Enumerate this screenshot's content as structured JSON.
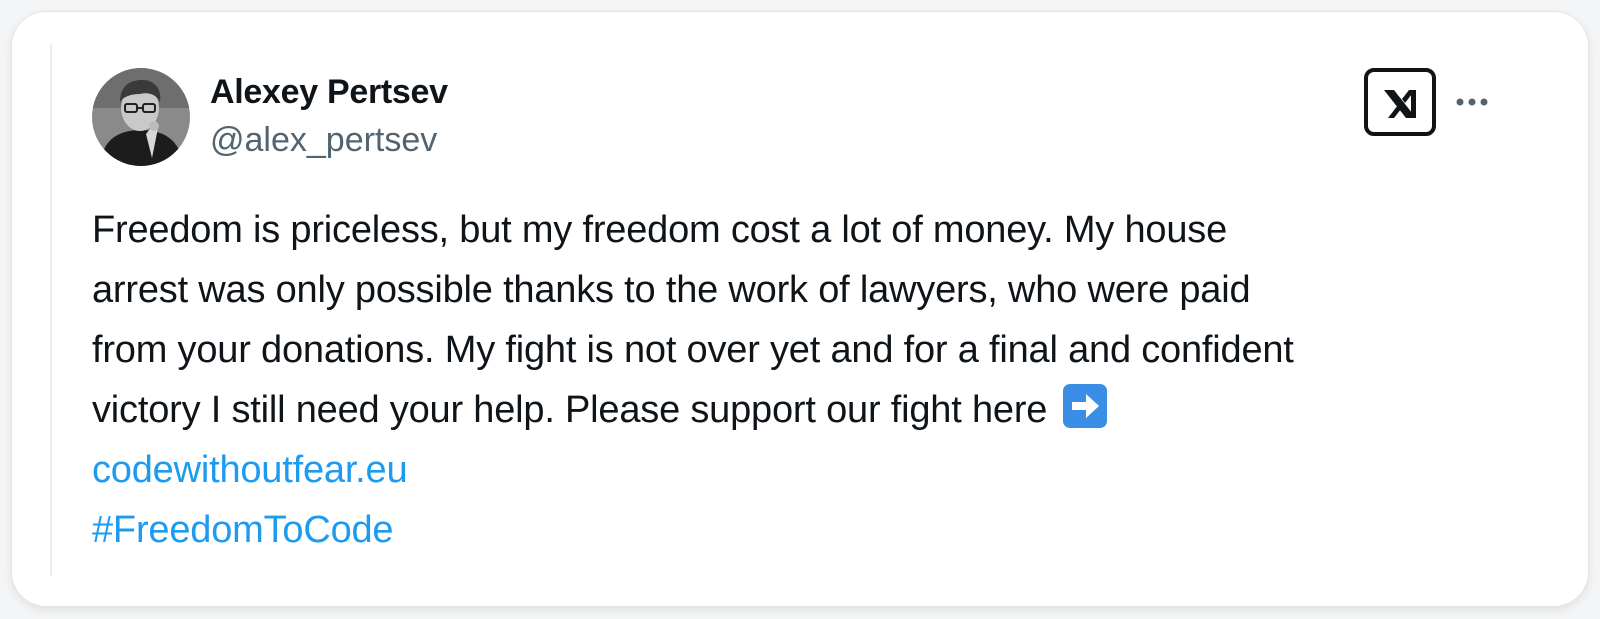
{
  "author": {
    "name": "Alexey Pertsev",
    "handle": "@alex_pertsev"
  },
  "icons": {
    "avatar": "profile-photo",
    "logo": "x-logo-icon",
    "more": "more-dots-icon",
    "emoji": "right-arrow-emoji"
  },
  "tweet": {
    "lines": [
      "Freedom is priceless, but my freedom cost a lot of money. My house",
      "arrest was only possible thanks to the work of lawyers, who were paid",
      "from your donations. My fight is not over yet and for a final and confident",
      "victory I still need your help. Please support our fight here "
    ],
    "link": "codewithoutfear.eu",
    "hashtag": "#FreedomToCode"
  },
  "colors": {
    "text": "#0f1419",
    "secondary": "#536471",
    "link": "#1d9bf0",
    "emoji_bg": "#3a8ee6"
  }
}
